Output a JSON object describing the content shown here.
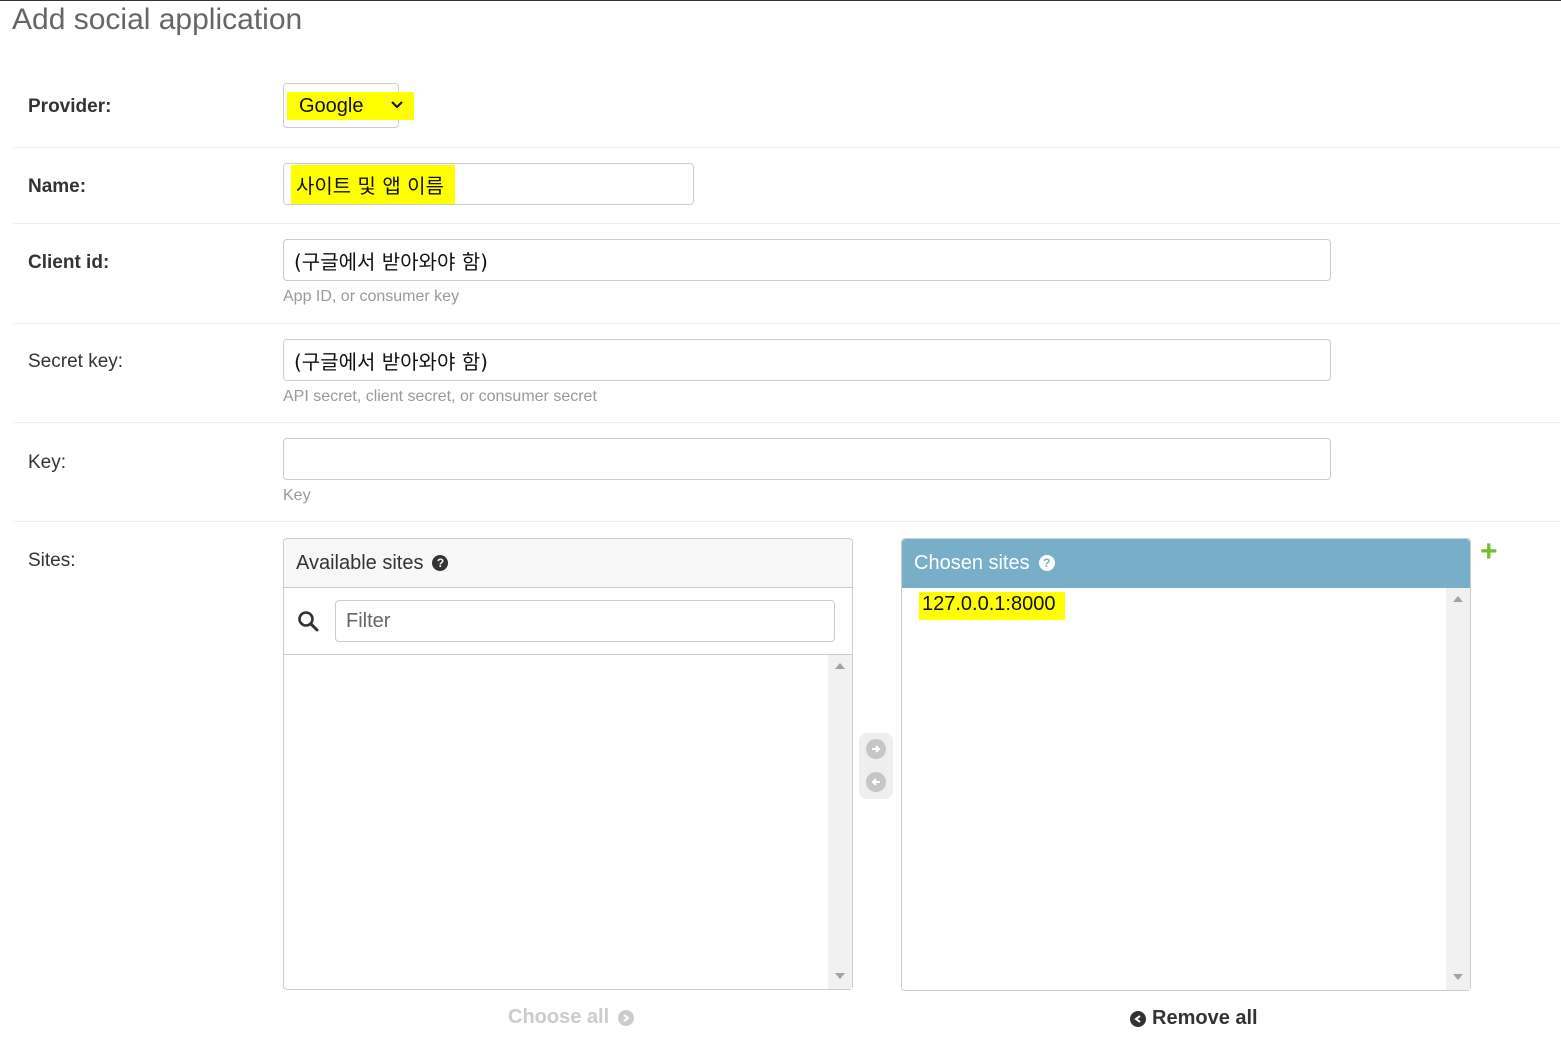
{
  "page": {
    "title": "Add social application"
  },
  "form": {
    "provider": {
      "label": "Provider:",
      "value": "Google"
    },
    "name": {
      "label": "Name:",
      "value": "사이트 및 앱 이름"
    },
    "client_id": {
      "label": "Client id:",
      "value": "(구글에서 받아와야 함)",
      "help": "App ID, or consumer key"
    },
    "secret_key": {
      "label": "Secret key:",
      "value": "(구글에서 받아와야 함)",
      "help": "API secret, client secret, or consumer secret"
    },
    "key": {
      "label": "Key:",
      "value": "",
      "help": "Key"
    },
    "sites": {
      "label": "Sites:",
      "available_title": "Available sites",
      "chosen_title": "Chosen sites",
      "filter_placeholder": "Filter",
      "chosen_items": [
        "127.0.0.1:8000"
      ],
      "choose_all": "Choose all",
      "remove_all": "Remove all"
    }
  },
  "icons": {
    "help": "question-circle-icon",
    "search": "magnifier-icon",
    "add": "plus-icon",
    "move_right": "arrow-right-circle-icon",
    "move_left": "arrow-left-circle-icon"
  },
  "colors": {
    "chosen_header": "#79aec8",
    "highlight": "#ffff00",
    "add_green": "#70bf2b"
  }
}
